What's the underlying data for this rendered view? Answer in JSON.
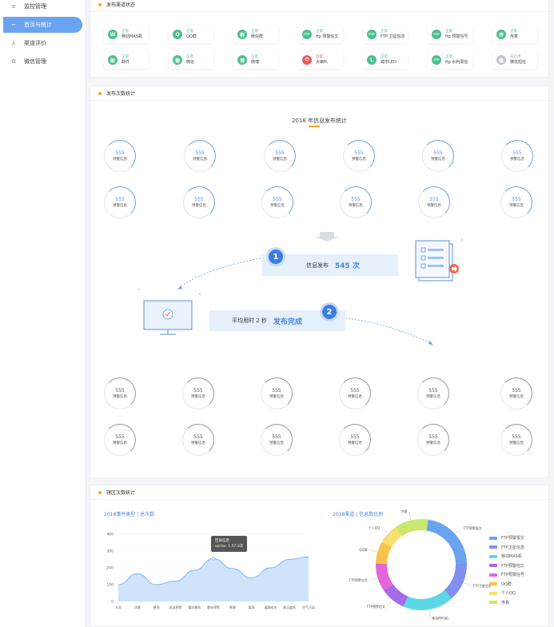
{
  "sidebar": {
    "items": [
      {
        "icon": "≡",
        "label": "监控管理",
        "active": false
      },
      {
        "icon": "⌐",
        "label": "首页与统计",
        "active": true
      },
      {
        "icon": "⅄",
        "label": "渠道评价",
        "active": false
      },
      {
        "icon": "⧉",
        "label": "微信管理",
        "active": false
      }
    ]
  },
  "channels": {
    "title": "发布渠道状态",
    "items": [
      {
        "status": "正常",
        "name": "移动MAS机",
        "glyph": "W",
        "tone": "green"
      },
      {
        "status": "正常",
        "name": "QQ群",
        "glyph": "Q",
        "tone": "green"
      },
      {
        "status": "正常",
        "name": "微信群",
        "glyph": "群",
        "tone": "green"
      },
      {
        "status": "正常",
        "name": "ftp 预警信文",
        "glyph": "FTP",
        "tone": "green"
      },
      {
        "status": "正常",
        "name": "FTP 卫星信息",
        "glyph": "FTP",
        "tone": "green"
      },
      {
        "status": "正常",
        "name": "ftp 预警信号",
        "glyph": "FTP",
        "tone": "green"
      },
      {
        "status": "正常",
        "name": "传真",
        "glyph": "传",
        "tone": "green"
      },
      {
        "status": "正常",
        "name": "邮件",
        "glyph": "邮",
        "tone": "green"
      },
      {
        "status": "正常",
        "name": "微信",
        "glyph": "微",
        "tone": "green"
      },
      {
        "status": "正常",
        "name": "微博",
        "glyph": "博",
        "tone": "green"
      },
      {
        "status": "异常",
        "name": "大喇叭",
        "glyph": "⏻",
        "tone": "red"
      },
      {
        "status": "正常",
        "name": "城市LED",
        "glyph": "L",
        "tone": "green"
      },
      {
        "status": "正常",
        "name": "ftp 水利局信",
        "glyph": "FTP",
        "tone": "green"
      },
      {
        "status": "未启用",
        "name": "微信短信",
        "glyph": "微",
        "tone": "gray"
      }
    ]
  },
  "publish": {
    "title": "发布次数统计",
    "chart_title": "2018 年信息发布统计",
    "ring_value": "555",
    "ring_label": "预警信息",
    "banner1_label": "信息发布",
    "banner1_value": "545 次",
    "banner2_label": "平均用时 2 秒",
    "banner2_value": "发布完成",
    "badge1": "1",
    "badge2": "2"
  },
  "region": {
    "title": "辖区次数统计",
    "line_subtitle": "2018事件类型 | 总次数",
    "pie_subtitle": "2018渠道 | 信息数比例",
    "tooltip_title": "区县信息",
    "tooltip_value": "series: 1.57.3次"
  },
  "chart_data": [
    {
      "type": "area",
      "title": "2018事件类型 | 总次数",
      "categories": [
        "大风",
        "冰雹",
        "暴雨",
        "高温预警",
        "霜冻暴雨",
        "雷电预警",
        "寒潮",
        "霜冻",
        "道路结冰",
        "能见度低",
        "空气污染"
      ],
      "values": [
        100,
        165,
        100,
        120,
        185,
        255,
        195,
        140,
        200,
        250,
        265
      ],
      "ylim": [
        0,
        400
      ],
      "yticks": [
        0,
        100,
        200,
        300,
        400
      ],
      "colors": {
        "line": "#7eb6f2",
        "fill": "#cfe3fa"
      }
    },
    {
      "type": "pie",
      "title": "2018渠道 | 信息数比例",
      "series": [
        {
          "name": "FTP预警报文",
          "value": 22,
          "color": "#6aa4f0"
        },
        {
          "name": "FTP卫星信息",
          "value": 14,
          "color": "#7f8ff2"
        },
        {
          "name": "移动MAS机",
          "value": 18,
          "color": "#5bd7e6"
        },
        {
          "name": "FTP预警信文",
          "value": 9,
          "color": "#a56be8"
        },
        {
          "name": "FTP预警信号",
          "value": 10,
          "color": "#e466d9"
        },
        {
          "name": "QQ群",
          "value": 8,
          "color": "#f7c34d"
        },
        {
          "name": "个人QQ",
          "value": 7,
          "color": "#f7e06d"
        },
        {
          "name": "传真",
          "value": 12,
          "color": "#c9e86b"
        }
      ],
      "donut_labels": [
        "传真",
        "移动MAS机",
        "移动MAS机",
        "FTP卫星信息",
        "FTP预警报文",
        "FTP预警信号",
        "QQ群",
        "个人QQ"
      ]
    }
  ]
}
